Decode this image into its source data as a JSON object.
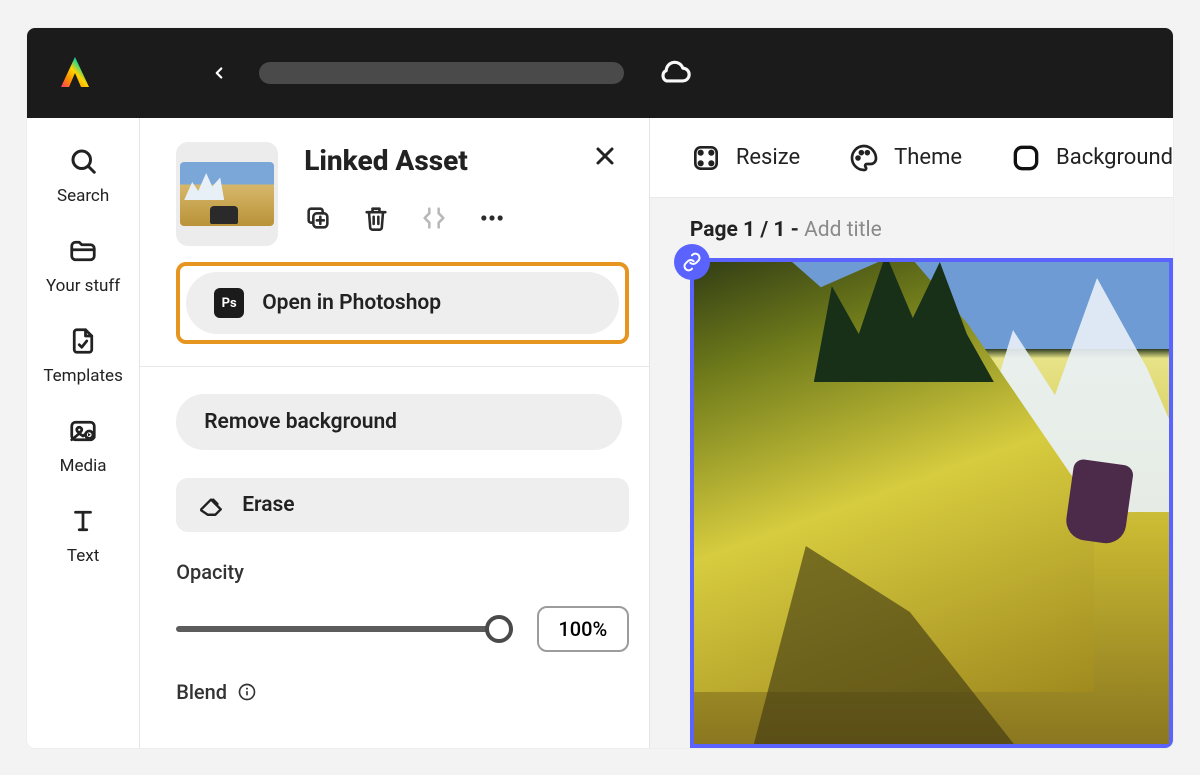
{
  "rail": {
    "search": "Search",
    "your_stuff": "Your stuff",
    "templates": "Templates",
    "media": "Media",
    "text": "Text"
  },
  "panel": {
    "title": "Linked Asset",
    "open_in_photoshop": "Open in Photoshop",
    "ps_badge": "Ps",
    "remove_background": "Remove background",
    "erase": "Erase",
    "opacity_label": "Opacity",
    "opacity_value": "100%",
    "blend_label": "Blend"
  },
  "canvas": {
    "resize": "Resize",
    "theme": "Theme",
    "background": "Background",
    "page_prefix": "Page 1 / 1 - ",
    "page_placeholder": "Add title"
  }
}
